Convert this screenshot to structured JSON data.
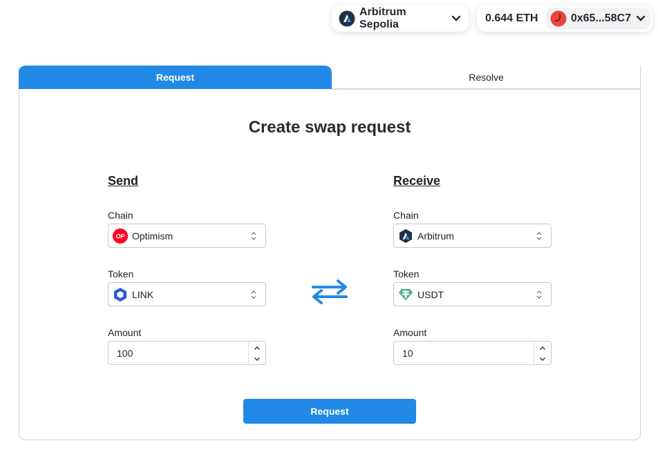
{
  "header": {
    "network": {
      "name": "Arbitrum Sepolia",
      "icon": "arbitrum-icon"
    },
    "account": {
      "balance": "0.644 ETH",
      "address": "0x65...58C7",
      "avatar_color": "#e8453c"
    }
  },
  "tabs": [
    {
      "label": "Request",
      "active": true
    },
    {
      "label": "Resolve",
      "active": false
    }
  ],
  "form": {
    "title": "Create swap request",
    "send": {
      "heading": "Send",
      "chain_label": "Chain",
      "chain": {
        "value": "Optimism",
        "icon": "optimism-icon",
        "color": "#ff0420"
      },
      "token_label": "Token",
      "token": {
        "value": "LINK",
        "icon": "chainlink-icon",
        "color": "#2a5ada"
      },
      "amount_label": "Amount",
      "amount": "100"
    },
    "receive": {
      "heading": "Receive",
      "chain_label": "Chain",
      "chain": {
        "value": "Arbitrum",
        "icon": "arbitrum-icon",
        "color": "#213147"
      },
      "token_label": "Token",
      "token": {
        "value": "USDT",
        "icon": "tether-icon",
        "color": "#50af95"
      },
      "amount_label": "Amount",
      "amount": "10"
    },
    "swap_icon": "swap-arrows-icon",
    "submit_label": "Request"
  },
  "colors": {
    "accent": "#2289e6"
  }
}
